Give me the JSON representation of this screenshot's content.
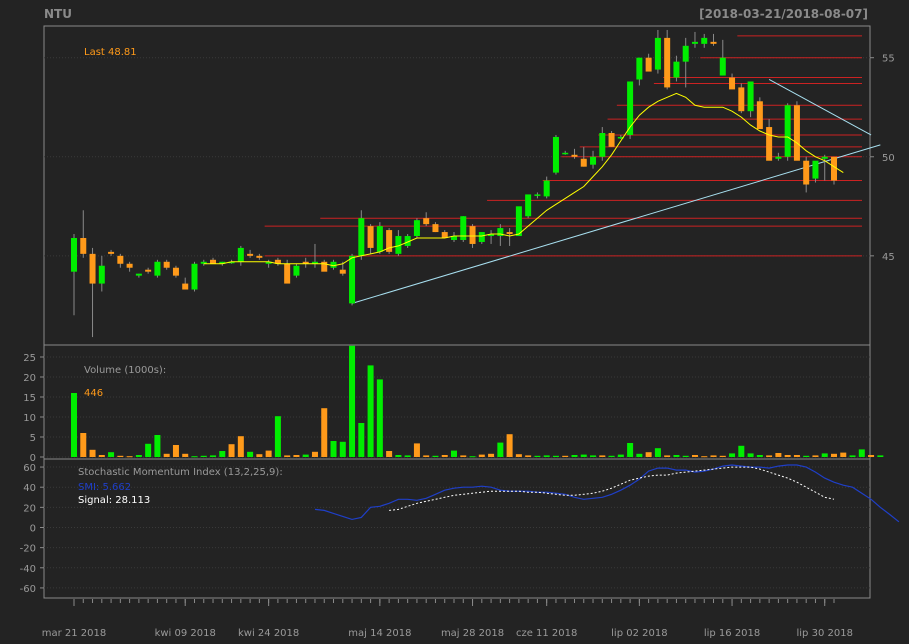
{
  "header": {
    "symbol": "NTU",
    "date_range": "[2018-03-21/2018-08-07]"
  },
  "colors": {
    "background": "#232323",
    "up": "#00ee00",
    "down": "#ff9a1a",
    "sma": "#ffff00",
    "resistance": "#cc2222",
    "trendline": "#a8e0f0",
    "smi": "#1f3fc8",
    "signal": "#ffffff",
    "grid": "#3a3a3a",
    "text": "#9a9a9a"
  },
  "chart_data": [
    {
      "type": "candlestick",
      "panel": "price",
      "title": "NTU",
      "subtitle": "[2018-03-21/2018-08-07]",
      "last_label": "Last 48.81",
      "yticks": [
        45,
        50,
        55
      ],
      "ylim": [
        40.5,
        56.6
      ],
      "x_labels": [
        "mar 21 2018",
        "kwi 09 2018",
        "kwi 24 2018",
        "maj 14 2018",
        "maj 28 2018",
        "cze 11 2018",
        "lip 02 2018",
        "lip 16 2018",
        "lip 30 2018"
      ],
      "x_label_index": [
        0,
        12,
        21,
        33,
        43,
        51,
        61,
        71,
        81
      ],
      "ohlc": [
        [
          44.2,
          46.1,
          42.0,
          45.9
        ],
        [
          45.9,
          47.3,
          44.9,
          45.1
        ],
        [
          45.1,
          45.4,
          40.9,
          43.6
        ],
        [
          43.6,
          45.0,
          43.2,
          44.5
        ],
        [
          45.2,
          45.3,
          45.0,
          45.1
        ],
        [
          45.0,
          45.1,
          44.4,
          44.6
        ],
        [
          44.6,
          44.7,
          44.2,
          44.4
        ],
        [
          44.0,
          44.1,
          43.9,
          44.1
        ],
        [
          44.3,
          44.4,
          44.1,
          44.2
        ],
        [
          44.0,
          44.8,
          43.9,
          44.7
        ],
        [
          44.7,
          44.8,
          44.3,
          44.4
        ],
        [
          44.4,
          44.5,
          43.9,
          44.0
        ],
        [
          43.6,
          43.9,
          43.4,
          43.3
        ],
        [
          43.3,
          44.7,
          43.2,
          44.6
        ],
        [
          44.6,
          44.8,
          44.5,
          44.7
        ],
        [
          44.8,
          44.9,
          44.6,
          44.6
        ],
        [
          44.6,
          44.7,
          44.5,
          44.7
        ],
        [
          44.7,
          44.8,
          44.6,
          44.7
        ],
        [
          44.7,
          45.5,
          44.5,
          45.4
        ],
        [
          45.1,
          45.3,
          44.9,
          45.0
        ],
        [
          45.0,
          45.1,
          44.8,
          44.9
        ],
        [
          44.6,
          44.8,
          44.4,
          44.7
        ],
        [
          44.8,
          44.9,
          44.5,
          44.6
        ],
        [
          44.6,
          44.8,
          44.0,
          43.6
        ],
        [
          44.0,
          44.6,
          43.9,
          44.5
        ],
        [
          44.7,
          44.9,
          44.4,
          44.6
        ],
        [
          44.6,
          45.6,
          44.4,
          44.7
        ],
        [
          44.7,
          44.8,
          44.3,
          44.2
        ],
        [
          44.4,
          44.8,
          44.3,
          44.7
        ],
        [
          44.3,
          44.7,
          44.0,
          44.1
        ],
        [
          42.6,
          45.1,
          42.5,
          45.0
        ],
        [
          45.0,
          47.3,
          44.8,
          46.9
        ],
        [
          46.5,
          46.6,
          45.1,
          45.4
        ],
        [
          45.2,
          46.7,
          45.1,
          46.5
        ],
        [
          46.3,
          46.4,
          45.1,
          45.2
        ],
        [
          45.1,
          46.3,
          45.0,
          46.0
        ],
        [
          45.5,
          46.1,
          45.4,
          46.0
        ],
        [
          46.0,
          46.9,
          45.9,
          46.8
        ],
        [
          46.9,
          47.2,
          46.5,
          46.6
        ],
        [
          46.6,
          46.7,
          46.2,
          46.2
        ],
        [
          46.2,
          46.3,
          45.9,
          45.9
        ],
        [
          45.8,
          46.2,
          45.7,
          46.0
        ],
        [
          45.8,
          47.0,
          45.7,
          47.0
        ],
        [
          46.5,
          46.6,
          45.4,
          45.6
        ],
        [
          45.7,
          46.1,
          45.6,
          46.2
        ],
        [
          46.0,
          46.3,
          45.6,
          46.1
        ],
        [
          46.0,
          46.6,
          45.5,
          46.4
        ],
        [
          46.2,
          46.4,
          45.5,
          46.1
        ],
        [
          46.0,
          47.4,
          46.0,
          47.5
        ],
        [
          47.0,
          47.9,
          46.9,
          48.1
        ],
        [
          48.1,
          48.2,
          47.9,
          48.1
        ],
        [
          48.0,
          49.0,
          47.9,
          48.8
        ],
        [
          49.2,
          51.1,
          49.1,
          51.0
        ],
        [
          50.2,
          50.3,
          50.1,
          50.2
        ],
        [
          50.1,
          50.4,
          49.9,
          50.0
        ],
        [
          49.9,
          50.5,
          49.5,
          49.5
        ],
        [
          49.6,
          50.3,
          49.4,
          50.0
        ],
        [
          50.0,
          51.5,
          49.8,
          51.2
        ],
        [
          51.2,
          51.3,
          50.5,
          50.5
        ],
        [
          51.0,
          51.1,
          50.9,
          51.0
        ],
        [
          51.1,
          53.0,
          50.9,
          53.8
        ],
        [
          53.9,
          55.0,
          53.6,
          55.0
        ],
        [
          55.0,
          55.2,
          54.7,
          54.3
        ],
        [
          54.4,
          56.4,
          54.2,
          56.0
        ],
        [
          56.0,
          56.4,
          53.4,
          53.5
        ],
        [
          54.0,
          55.1,
          53.8,
          54.8
        ],
        [
          54.8,
          56.0,
          53.5,
          55.6
        ],
        [
          55.7,
          56.3,
          55.5,
          55.8
        ],
        [
          55.7,
          56.2,
          55.5,
          56.0
        ],
        [
          55.8,
          56.2,
          55.6,
          55.7
        ],
        [
          54.1,
          55.9,
          54.1,
          55.0
        ],
        [
          54.0,
          54.2,
          53.5,
          53.4
        ],
        [
          53.5,
          53.7,
          52.2,
          52.3
        ],
        [
          52.3,
          53.6,
          52.0,
          53.8
        ],
        [
          52.8,
          53.0,
          51.8,
          51.4
        ],
        [
          51.5,
          51.9,
          50.8,
          49.8
        ],
        [
          49.9,
          50.2,
          49.8,
          50.0
        ],
        [
          50.0,
          52.7,
          49.8,
          52.6
        ],
        [
          52.6,
          52.8,
          49.9,
          49.8
        ],
        [
          49.8,
          50.0,
          48.2,
          48.6
        ],
        [
          48.9,
          49.6,
          48.7,
          49.8
        ],
        [
          49.9,
          50.1,
          48.8,
          50.0
        ],
        [
          50.0,
          49.0,
          48.6,
          48.8
        ]
      ],
      "sma_start": 14,
      "sma": [
        44.6,
        44.6,
        44.6,
        44.7,
        44.7,
        44.7,
        44.7,
        44.7,
        44.6,
        44.6,
        44.6,
        44.6,
        44.6,
        44.6,
        44.5,
        44.6,
        44.9,
        45.0,
        45.1,
        45.2,
        45.4,
        45.5,
        45.7,
        45.9,
        45.9,
        45.9,
        45.9,
        46.0,
        46.0,
        46.0,
        46.0,
        46.1,
        46.1,
        46.0,
        46.1,
        46.5,
        46.9,
        47.3,
        47.6,
        47.9,
        48.2,
        48.5,
        49.0,
        49.5,
        50.1,
        50.8,
        51.5,
        52.1,
        52.5,
        52.8,
        53.0,
        53.2,
        53.0,
        52.6,
        52.5,
        52.5,
        52.5,
        52.3,
        52.0,
        51.6,
        51.3,
        51.1,
        51.0,
        51.0,
        50.7,
        50.3,
        50.0,
        49.8,
        49.5,
        49.2
      ],
      "resistance_lines": [
        {
          "y": 56.1,
          "from": 72
        },
        {
          "y": 55.0,
          "from": 68
        },
        {
          "y": 54.0,
          "from": 64
        },
        {
          "y": 53.7,
          "from": 63
        },
        {
          "y": 52.6,
          "from": 59
        },
        {
          "y": 51.9,
          "from": 58
        },
        {
          "y": 51.1,
          "from": 57
        },
        {
          "y": 50.5,
          "from": 55
        },
        {
          "y": 50.0,
          "from": 53
        },
        {
          "y": 48.8,
          "from": 51
        },
        {
          "y": 47.8,
          "from": 45
        },
        {
          "y": 46.9,
          "from": 27
        },
        {
          "y": 46.5,
          "from": 21
        },
        {
          "y": 45.0,
          "from": 21
        }
      ],
      "trendlines": [
        {
          "from": [
            30,
            42.6
          ],
          "to": [
            87,
            50.6
          ]
        },
        {
          "from": [
            75,
            53.9
          ],
          "to": [
            86,
            51.1
          ]
        }
      ]
    },
    {
      "type": "bar",
      "panel": "volume",
      "title": "Volume (1000s):",
      "last_value": "446",
      "yticks": [
        0,
        5,
        10,
        15,
        20,
        25
      ],
      "ylim": [
        0,
        28
      ],
      "values": [
        16,
        6,
        1.8,
        0.5,
        1.2,
        0.3,
        0.2,
        0.5,
        3.3,
        5.5,
        0.8,
        3.0,
        0.8,
        0.2,
        0.3,
        0.4,
        1.5,
        3.2,
        5.2,
        1.3,
        0.7,
        1.6,
        10.2,
        0.4,
        0.5,
        0.6,
        1.3,
        12.2,
        4.0,
        3.8,
        27.8,
        8.5,
        22.9,
        19.4,
        1.5,
        0.5,
        0.4,
        3.4,
        0.4,
        0.3,
        0.5,
        1.6,
        0.4,
        0.2,
        0.6,
        0.8,
        3.6,
        5.7,
        0.7,
        0.4,
        0.3,
        0.4,
        0.3,
        0.3,
        0.5,
        0.6,
        0.4,
        0.4,
        0.3,
        0.6,
        3.5,
        0.8,
        1.2,
        2.2,
        0.4,
        0.5,
        0.3,
        0.5,
        0.2,
        0.4,
        0.3,
        0.9,
        2.8,
        0.9,
        0.5,
        0.4,
        1.0,
        0.5,
        0.5,
        0.3,
        0.4,
        0.9,
        0.8,
        1.1,
        0.4,
        1.9,
        0.5,
        0.4
      ],
      "up": [
        1,
        0,
        0,
        0,
        1,
        0,
        0,
        1,
        1,
        1,
        0,
        0,
        0,
        1,
        1,
        1,
        1,
        0,
        0,
        1,
        0,
        0,
        1,
        0,
        0,
        1,
        0,
        0,
        1,
        1,
        1,
        1,
        1,
        1,
        0,
        1,
        1,
        0,
        0,
        1,
        0,
        1,
        0,
        1,
        0,
        0,
        1,
        0,
        0,
        0,
        1,
        1,
        1,
        0,
        1,
        1,
        1,
        0,
        1,
        1,
        1,
        1,
        0,
        1,
        0,
        1,
        1,
        0,
        0,
        0,
        0,
        1,
        1,
        1,
        1,
        0,
        0,
        0,
        0,
        1,
        0,
        1,
        0,
        0,
        1,
        1,
        0,
        1
      ]
    },
    {
      "type": "line",
      "panel": "indicator",
      "title": "Stochastic Momentum Index (13,2,25,9):",
      "smi_label": "SMI: 5.662",
      "signal_label": "Signal: 28.113",
      "yticks": [
        60,
        40,
        20,
        0,
        -20,
        -40,
        -60
      ],
      "ylim": [
        -70,
        68
      ],
      "smi_start": 26,
      "smi": [
        18,
        17,
        14,
        11,
        8,
        10,
        20,
        21,
        24,
        28,
        28,
        27,
        29,
        33,
        37,
        39,
        40,
        40,
        41,
        40,
        37,
        36,
        36,
        36,
        35,
        35,
        34,
        33,
        30,
        28,
        29,
        30,
        33,
        37,
        42,
        48,
        56,
        59,
        59,
        57,
        57,
        55,
        56,
        58,
        61,
        62,
        61,
        60,
        60,
        59,
        61,
        62,
        62,
        60,
        55,
        49,
        45,
        42,
        40,
        34,
        28,
        20,
        13,
        5.66
      ],
      "signal_start": 34,
      "signal": [
        17,
        18,
        21,
        24,
        26,
        28,
        30,
        32,
        33,
        34,
        35,
        36,
        36,
        36,
        36,
        35,
        35,
        34,
        33,
        32,
        32,
        33,
        34,
        36,
        39,
        43,
        47,
        49,
        51,
        52,
        52,
        54,
        55,
        56,
        57,
        58,
        59,
        60,
        60,
        60,
        58,
        55,
        52,
        49,
        45,
        40,
        35,
        30,
        28.11
      ]
    }
  ]
}
